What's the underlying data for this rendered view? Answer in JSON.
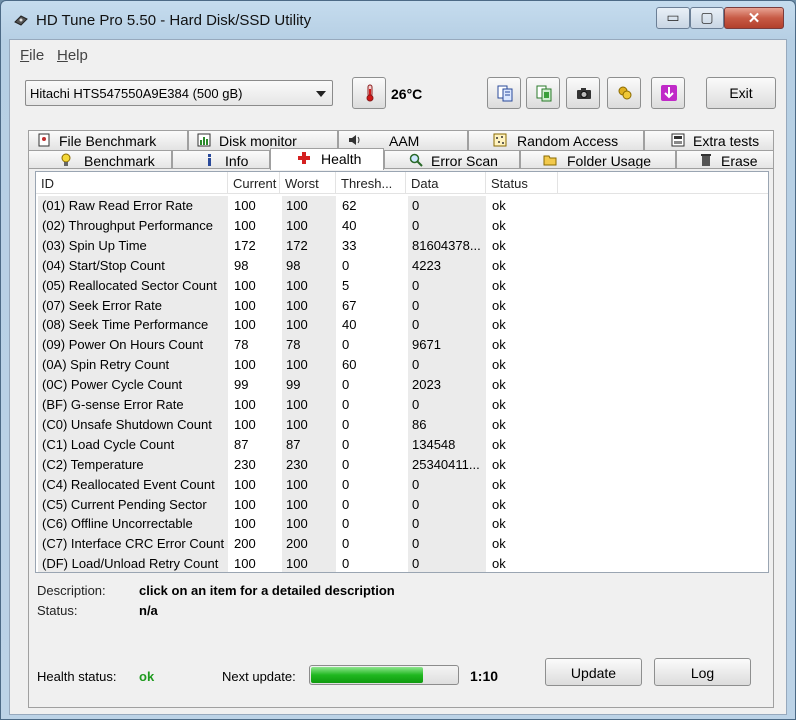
{
  "window": {
    "title": "HD Tune Pro 5.50 - Hard Disk/SSD Utility",
    "controls": {
      "minimize": "▭",
      "maximize": "▢",
      "close": "✕"
    }
  },
  "menu": {
    "file": "File",
    "help": "Help"
  },
  "toolbar": {
    "drive": "Hitachi HTS547550A9E384 (500 gB)",
    "temperature": "26°C",
    "exit_label": "Exit",
    "icons": [
      "copy-text-icon",
      "copy-screenshot-icon",
      "camera-icon",
      "options-icon",
      "save-download-icon"
    ]
  },
  "tabs": {
    "top_row": [
      "File Benchmark",
      "Disk monitor",
      "AAM",
      "Random Access",
      "Extra tests"
    ],
    "bottom_row": [
      "Benchmark",
      "Info",
      "Health",
      "Error Scan",
      "Folder Usage",
      "Erase"
    ],
    "active": "Health"
  },
  "smart_table": {
    "columns": [
      "ID",
      "Current",
      "Worst",
      "Thresh...",
      "Data",
      "Status"
    ],
    "rows": [
      [
        "(01) Raw Read Error Rate",
        "100",
        "100",
        "62",
        "0",
        "ok"
      ],
      [
        "(02) Throughput Performance",
        "100",
        "100",
        "40",
        "0",
        "ok"
      ],
      [
        "(03) Spin Up Time",
        "172",
        "172",
        "33",
        "81604378...",
        "ok"
      ],
      [
        "(04) Start/Stop Count",
        "98",
        "98",
        "0",
        "4223",
        "ok"
      ],
      [
        "(05) Reallocated Sector Count",
        "100",
        "100",
        "5",
        "0",
        "ok"
      ],
      [
        "(07) Seek Error Rate",
        "100",
        "100",
        "67",
        "0",
        "ok"
      ],
      [
        "(08) Seek Time Performance",
        "100",
        "100",
        "40",
        "0",
        "ok"
      ],
      [
        "(09) Power On Hours Count",
        "78",
        "78",
        "0",
        "9671",
        "ok"
      ],
      [
        "(0A) Spin Retry Count",
        "100",
        "100",
        "60",
        "0",
        "ok"
      ],
      [
        "(0C) Power Cycle Count",
        "99",
        "99",
        "0",
        "2023",
        "ok"
      ],
      [
        "(BF) G-sense Error Rate",
        "100",
        "100",
        "0",
        "0",
        "ok"
      ],
      [
        "(C0) Unsafe Shutdown Count",
        "100",
        "100",
        "0",
        "86",
        "ok"
      ],
      [
        "(C1) Load Cycle Count",
        "87",
        "87",
        "0",
        "134548",
        "ok"
      ],
      [
        "(C2) Temperature",
        "230",
        "230",
        "0",
        "25340411...",
        "ok"
      ],
      [
        "(C4) Reallocated Event Count",
        "100",
        "100",
        "0",
        "0",
        "ok"
      ],
      [
        "(C5) Current Pending Sector",
        "100",
        "100",
        "0",
        "0",
        "ok"
      ],
      [
        "(C6) Offline Uncorrectable",
        "100",
        "100",
        "0",
        "0",
        "ok"
      ],
      [
        "(C7) Interface CRC Error Count",
        "200",
        "200",
        "0",
        "0",
        "ok"
      ],
      [
        "(DF) Load/Unload Retry Count",
        "100",
        "100",
        "0",
        "0",
        "ok"
      ]
    ]
  },
  "details": {
    "description_label": "Description:",
    "description_value": "click on an item for a detailed description",
    "status_label": "Status:",
    "status_value": "n/a"
  },
  "footer": {
    "health_label": "Health status:",
    "health_value": "ok",
    "next_update_label": "Next update:",
    "progress_fraction": 0.76,
    "countdown": "1:10",
    "update_label": "Update",
    "log_label": "Log"
  },
  "colors": {
    "health_ok": "#1e9a1e",
    "progress": "#20b820",
    "health_tab_cross": "#d42020"
  }
}
